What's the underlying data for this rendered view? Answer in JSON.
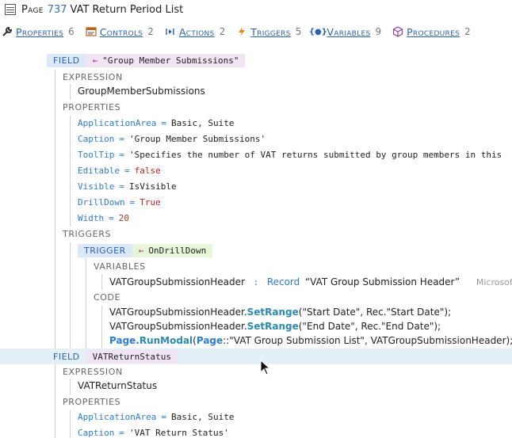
{
  "title": {
    "prefix": "Page",
    "number": "737",
    "name": "VAT Return Period List"
  },
  "tabs": [
    {
      "label": "Properties",
      "count": "6",
      "icon": "wrench-icon"
    },
    {
      "label": "Controls",
      "count": "2",
      "icon": "controls-icon"
    },
    {
      "label": "Actions",
      "count": "2",
      "icon": "actions-icon"
    },
    {
      "label": "Triggers",
      "count": "5",
      "icon": "lightning-icon"
    },
    {
      "label": "Variables",
      "count": "9",
      "icon": "braces-icon"
    },
    {
      "label": "Procedures",
      "count": "2",
      "icon": "cube-icon"
    }
  ],
  "field1": {
    "badge": "FIELD",
    "arrow": "←",
    "name": "\"Group Member Submissions\"",
    "expression_label": "EXPRESSION",
    "expression": "GroupMemberSubmissions",
    "properties_label": "PROPERTIES",
    "properties": [
      {
        "key": "ApplicationArea",
        "eq": "=",
        "value": "Basic, Suite"
      },
      {
        "key": "Caption",
        "eq": "=",
        "value": "'Group Member Submissions'"
      },
      {
        "key": "ToolTip",
        "eq": "=",
        "value": "'Specifies the number of VAT returns submitted by group members in this"
      },
      {
        "key": "Editable",
        "eq": "=",
        "value": "false"
      },
      {
        "key": "Visible",
        "eq": "=",
        "value": "IsVisible"
      },
      {
        "key": "DrillDown",
        "eq": "=",
        "value": "True"
      },
      {
        "key": "Width",
        "eq": "=",
        "value": "20"
      }
    ],
    "triggers_label": "TRIGGERS",
    "trigger": {
      "badge": "TRIGGER",
      "arrow": "←",
      "name": "OnDrillDown",
      "variables_label": "VARIABLES",
      "var_name": "VATGroupSubmissionHeader",
      "var_colon": ":",
      "var_type": "Record",
      "var_value": "“VAT Group Submission Header”",
      "var_comment": "Microsoft –",
      "code_label": "CODE",
      "code": [
        {
          "obj": "VATGroupSubmissionHeader.",
          "method": "SetRange",
          "args": "(\"Start Date\", Rec.\"Start Date\");"
        },
        {
          "obj": "VATGroupSubmissionHeader.",
          "method": "SetRange",
          "args": "(\"End Date\", Rec.\"End Date\");"
        },
        {
          "obj": "Page.",
          "method": "RunModal",
          "args_prefix": "(",
          "page_kw": "Page",
          "args": "::\"VAT Group Submission List\", VATGroupSubmissionHeader);"
        }
      ]
    }
  },
  "field2": {
    "badge": "FIELD",
    "name": "VATReturnStatus",
    "expression_label": "EXPRESSION",
    "expression": "VATReturnStatus",
    "properties_label": "PROPERTIES",
    "properties": [
      {
        "key": "ApplicationArea",
        "eq": "=",
        "value": "Basic, Suite"
      },
      {
        "key": "Caption",
        "eq": "=",
        "value": "'VAT Return Status'"
      }
    ]
  },
  "colors": {
    "link": "#2a62b0",
    "keyword": "#2d7bd4",
    "boolean": "#c81f1f",
    "highlight": "#e3f0f8"
  }
}
